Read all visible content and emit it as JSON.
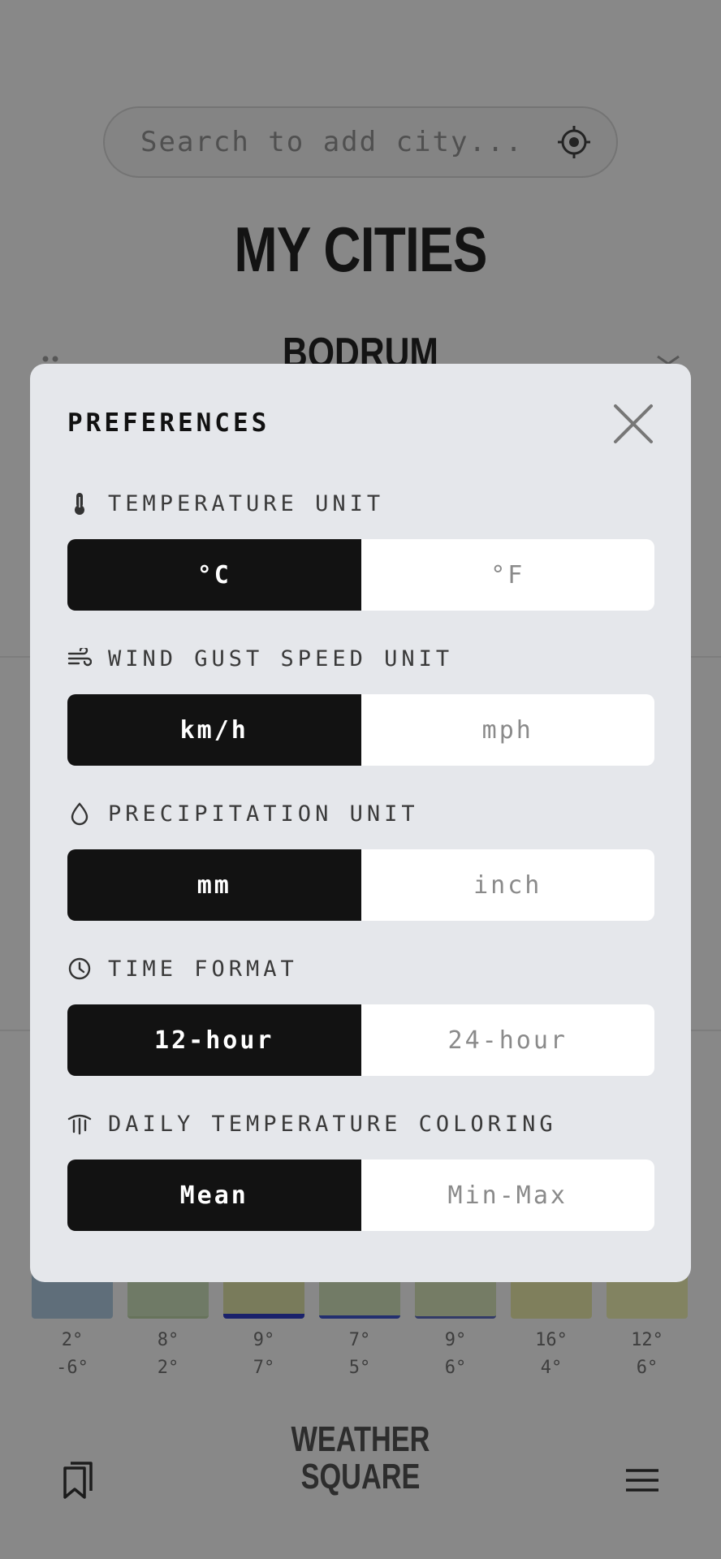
{
  "search": {
    "placeholder": "Search to add city..."
  },
  "header": {
    "title": "MY CITIES"
  },
  "city": {
    "name": "BODRUM"
  },
  "forecast": [
    {
      "high": "2°",
      "low": "-6°",
      "color": "#a9c6de",
      "accent": "#a9c6de"
    },
    {
      "high": "8°",
      "low": "2°",
      "color": "#c9dfb6",
      "accent": "#b8d0a0"
    },
    {
      "high": "9°",
      "low": "7°",
      "color": "#dde0a1",
      "accent": "#1e2fc1"
    },
    {
      "high": "7°",
      "low": "5°",
      "color": "#cfe0b7",
      "accent": "#2f48c9"
    },
    {
      "high": "9°",
      "low": "6°",
      "color": "#d5e2b4",
      "accent": "#5160b8"
    },
    {
      "high": "16°",
      "low": "4°",
      "color": "#e9e9a2",
      "accent": "#e9e9a2"
    },
    {
      "high": "12°",
      "low": "6°",
      "color": "#eff0ad",
      "accent": "#eff0ad"
    }
  ],
  "logo": {
    "line1": "WEATHER",
    "line2": "SQUARE"
  },
  "modal": {
    "title": "PREFERENCES",
    "sections": [
      {
        "label": "TEMPERATURE UNIT",
        "icon": "thermometer-icon",
        "options": [
          "°C",
          "°F"
        ],
        "selected": 0
      },
      {
        "label": "WIND GUST SPEED UNIT",
        "icon": "wind-icon",
        "options": [
          "km/h",
          "mph"
        ],
        "selected": 0
      },
      {
        "label": "PRECIPITATION UNIT",
        "icon": "droplet-icon",
        "options": [
          "mm",
          "inch"
        ],
        "selected": 0
      },
      {
        "label": "TIME FORMAT",
        "icon": "clock-icon",
        "options": [
          "12-hour",
          "24-hour"
        ],
        "selected": 0
      },
      {
        "label": "DAILY TEMPERATURE COLORING",
        "icon": "heat-waves-icon",
        "options": [
          "Mean",
          "Min-Max"
        ],
        "selected": 0
      }
    ]
  }
}
